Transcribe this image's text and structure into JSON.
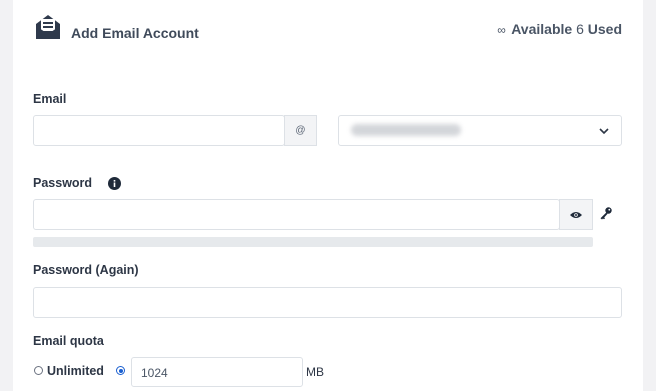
{
  "header": {
    "title": "Add Email Account",
    "infinity_symbol": "∞",
    "available_label": "Available",
    "used_count": "6",
    "used_label": "Used"
  },
  "email": {
    "label": "Email",
    "value": "",
    "at_symbol": "@"
  },
  "password": {
    "label": "Password",
    "value": ""
  },
  "password_again": {
    "label": "Password (Again)",
    "value": ""
  },
  "quota": {
    "label": "Email quota",
    "unlimited_label": "Unlimited",
    "value": "1024",
    "unit": "MB",
    "selected": "custom"
  },
  "colors": {
    "accent": "#1a5fd0",
    "border": "#dde1e6",
    "text": "#2d3645"
  }
}
